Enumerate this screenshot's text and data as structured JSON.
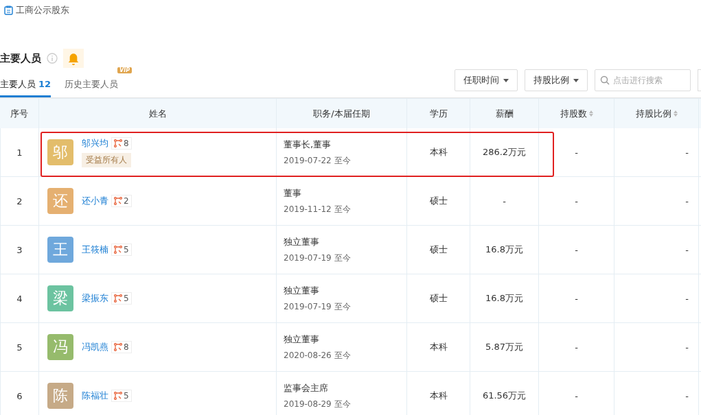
{
  "top_link": {
    "label": "工商公示股东"
  },
  "section": {
    "title": "主要人员"
  },
  "tabs": [
    {
      "label": "主要人员",
      "count": "12",
      "selected": true
    },
    {
      "label": "历史主要人员",
      "selected": false,
      "badge": "VIP"
    }
  ],
  "filters": [
    {
      "label": "任职时间",
      "kind": "dropdown"
    },
    {
      "label": "持股比例",
      "kind": "dropdown"
    },
    {
      "placeholder": "点击进行搜索",
      "kind": "search"
    }
  ],
  "table": {
    "columns": [
      {
        "label": "序号",
        "sortable": false
      },
      {
        "label": "姓名",
        "sortable": false
      },
      {
        "label": "职务/本届任期",
        "sortable": false
      },
      {
        "label": "学历",
        "sortable": false
      },
      {
        "label": "薪酬",
        "sortable": false
      },
      {
        "label": "持股数",
        "sortable": true
      },
      {
        "label": "持股比例",
        "sortable": true
      }
    ],
    "rows": [
      {
        "index": "1",
        "avatar": "邬",
        "color": "#e3bd6b",
        "name": "邬兴均",
        "links": "8",
        "tag": "受益所有人",
        "position": "董事长,董事",
        "term": "2019-07-22 至今",
        "education": "本科",
        "salary": "286.2万元",
        "shares": "-",
        "ratio": "-",
        "highlighted": true
      },
      {
        "index": "2",
        "avatar": "还",
        "color": "#e5b071",
        "name": "还小青",
        "links": "2",
        "position": "董事",
        "term": "2019-11-12 至今",
        "education": "硕士",
        "salary": "-",
        "shares": "-",
        "ratio": "-",
        "highlighted": false
      },
      {
        "index": "3",
        "avatar": "王",
        "color": "#6fa8dc",
        "name": "王筱楠",
        "links": "5",
        "position": "独立董事",
        "term": "2019-07-19 至今",
        "education": "硕士",
        "salary": "16.8万元",
        "shares": "-",
        "ratio": "-",
        "highlighted": false
      },
      {
        "index": "4",
        "avatar": "梁",
        "color": "#6cc3a0",
        "name": "梁振东",
        "links": "5",
        "position": "独立董事",
        "term": "2019-07-19 至今",
        "education": "硕士",
        "salary": "16.8万元",
        "shares": "-",
        "ratio": "-",
        "highlighted": false
      },
      {
        "index": "5",
        "avatar": "冯",
        "color": "#96bb6c",
        "name": "冯凯燕",
        "links": "8",
        "position": "独立董事",
        "term": "2020-08-26 至今",
        "education": "本科",
        "salary": "5.87万元",
        "shares": "-",
        "ratio": "-",
        "highlighted": false
      },
      {
        "index": "6",
        "avatar": "陈",
        "color": "#c6aa87",
        "name": "陈福壮",
        "links": "5",
        "position": "监事会主席",
        "term": "2019-08-29 至今",
        "education": "本科",
        "salary": "61.56万元",
        "shares": "-",
        "ratio": "-",
        "highlighted": false
      }
    ]
  }
}
